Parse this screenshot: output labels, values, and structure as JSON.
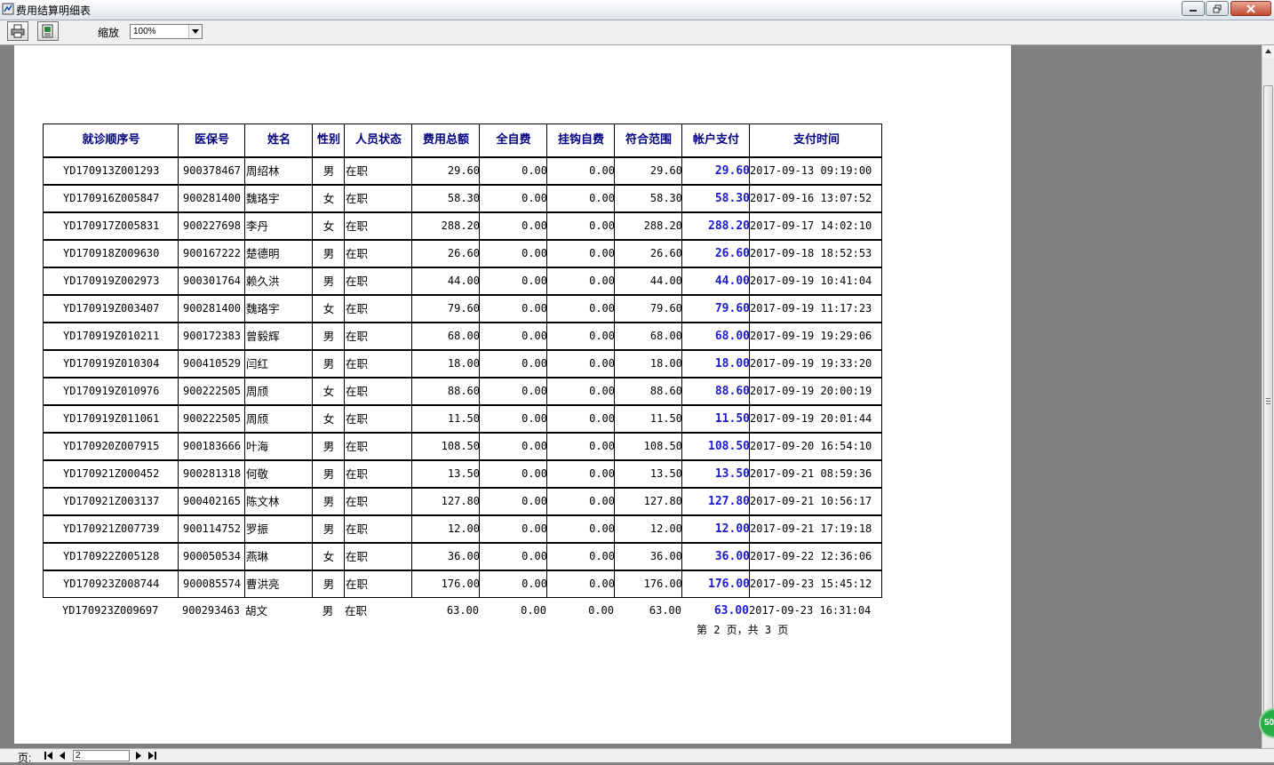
{
  "window": {
    "title": "费用结算明细表"
  },
  "toolbar": {
    "zoom_label": "缩放",
    "zoom_value": "100%"
  },
  "report": {
    "headers": [
      "就诊顺序号",
      "医保号",
      "姓名",
      "性别",
      "人员状态",
      "费用总额",
      "全自费",
      "挂钩自费",
      "符合范围",
      "帐户支付",
      "支付时间"
    ],
    "rows": [
      [
        "YD170913Z001293",
        "900378467",
        "周绍林",
        "男",
        "在职",
        "29.60",
        "0.00",
        "0.00",
        "29.60",
        "29.60",
        "2017-09-13 09:19:00"
      ],
      [
        "YD170916Z005847",
        "900281400",
        "魏珞宇",
        "女",
        "在职",
        "58.30",
        "0.00",
        "0.00",
        "58.30",
        "58.30",
        "2017-09-16 13:07:52"
      ],
      [
        "YD170917Z005831",
        "900227698",
        "李丹",
        "女",
        "在职",
        "288.20",
        "0.00",
        "0.00",
        "288.20",
        "288.20",
        "2017-09-17 14:02:10"
      ],
      [
        "YD170918Z009630",
        "900167222",
        "楚德明",
        "男",
        "在职",
        "26.60",
        "0.00",
        "0.00",
        "26.60",
        "26.60",
        "2017-09-18 18:52:53"
      ],
      [
        "YD170919Z002973",
        "900301764",
        "赖久洪",
        "男",
        "在职",
        "44.00",
        "0.00",
        "0.00",
        "44.00",
        "44.00",
        "2017-09-19 10:41:04"
      ],
      [
        "YD170919Z003407",
        "900281400",
        "魏珞宇",
        "女",
        "在职",
        "79.60",
        "0.00",
        "0.00",
        "79.60",
        "79.60",
        "2017-09-19 11:17:23"
      ],
      [
        "YD170919Z010211",
        "900172383",
        "曾毅辉",
        "男",
        "在职",
        "68.00",
        "0.00",
        "0.00",
        "68.00",
        "68.00",
        "2017-09-19 19:29:06"
      ],
      [
        "YD170919Z010304",
        "900410529",
        "闫红",
        "男",
        "在职",
        "18.00",
        "0.00",
        "0.00",
        "18.00",
        "18.00",
        "2017-09-19 19:33:20"
      ],
      [
        "YD170919Z010976",
        "900222505",
        "周颀",
        "女",
        "在职",
        "88.60",
        "0.00",
        "0.00",
        "88.60",
        "88.60",
        "2017-09-19 20:00:19"
      ],
      [
        "YD170919Z011061",
        "900222505",
        "周颀",
        "女",
        "在职",
        "11.50",
        "0.00",
        "0.00",
        "11.50",
        "11.50",
        "2017-09-19 20:01:44"
      ],
      [
        "YD170920Z007915",
        "900183666",
        "叶海",
        "男",
        "在职",
        "108.50",
        "0.00",
        "0.00",
        "108.50",
        "108.50",
        "2017-09-20 16:54:10"
      ],
      [
        "YD170921Z000452",
        "900281318",
        "何敬",
        "男",
        "在职",
        "13.50",
        "0.00",
        "0.00",
        "13.50",
        "13.50",
        "2017-09-21 08:59:36"
      ],
      [
        "YD170921Z003137",
        "900402165",
        "陈文林",
        "男",
        "在职",
        "127.80",
        "0.00",
        "0.00",
        "127.80",
        "127.80",
        "2017-09-21 10:56:17"
      ],
      [
        "YD170921Z007739",
        "900114752",
        "罗振",
        "男",
        "在职",
        "12.00",
        "0.00",
        "0.00",
        "12.00",
        "12.00",
        "2017-09-21 17:19:18"
      ],
      [
        "YD170922Z005128",
        "900050534",
        "燕琳",
        "女",
        "在职",
        "36.00",
        "0.00",
        "0.00",
        "36.00",
        "36.00",
        "2017-09-22 12:36:06"
      ],
      [
        "YD170923Z008744",
        "900085574",
        "曹洪亮",
        "男",
        "在职",
        "176.00",
        "0.00",
        "0.00",
        "176.00",
        "176.00",
        "2017-09-23 15:45:12"
      ],
      [
        "YD170923Z009697",
        "900293463",
        "胡文",
        "男",
        "在职",
        "63.00",
        "0.00",
        "0.00",
        "63.00",
        "63.00",
        "2017-09-23 16:31:04"
      ]
    ],
    "page_footer": "第 2 页，共 3 页"
  },
  "statusbar": {
    "page_label": "页:",
    "page_value": "2"
  },
  "badge": {
    "text": "50"
  },
  "colors": {
    "header_text": "#000080",
    "account_pay": "#1a1ad0"
  },
  "icons": [
    "print-icon",
    "export-icon",
    "minimize-icon",
    "restore-icon",
    "close-icon",
    "first-page-icon",
    "prev-page-icon",
    "next-page-icon",
    "last-page-icon"
  ]
}
